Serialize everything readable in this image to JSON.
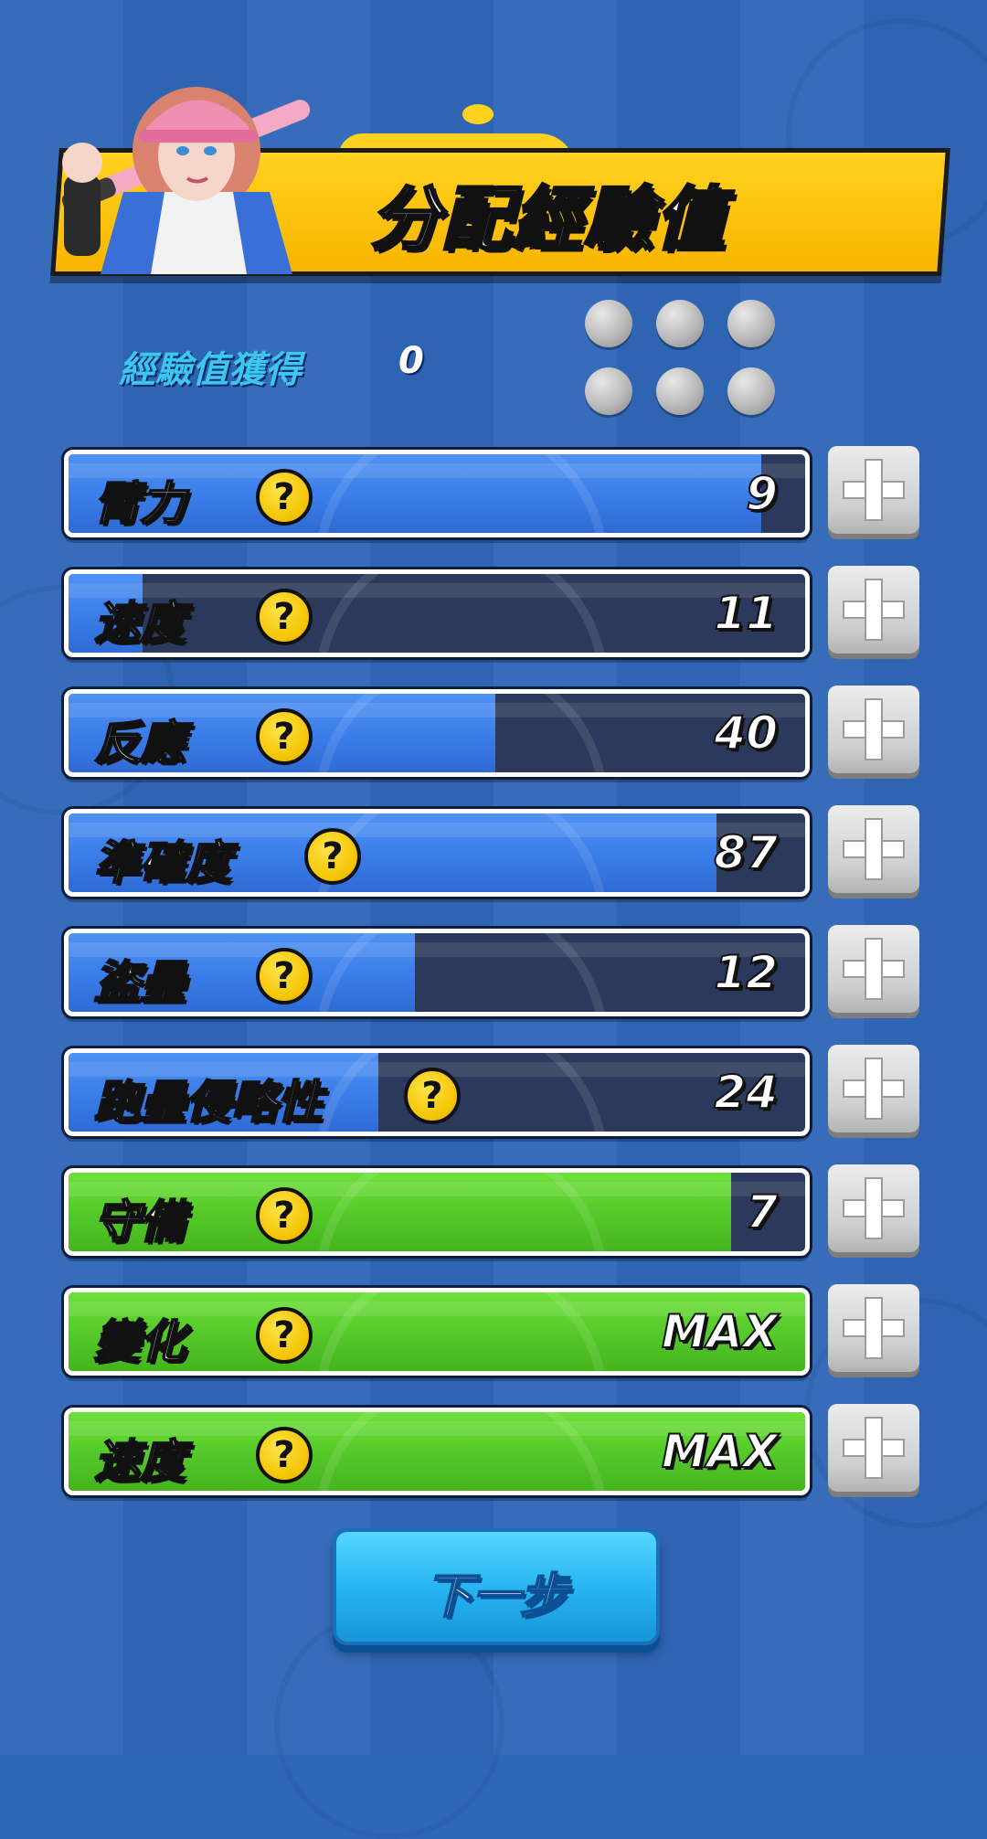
{
  "header": {
    "title": "分配經驗值"
  },
  "exp": {
    "label": "經驗值獲得",
    "value": "0"
  },
  "stats": [
    {
      "name": "臂力",
      "value": "9",
      "fill": 0.94,
      "color": "blue"
    },
    {
      "name": "速度",
      "value": "11",
      "fill": 0.1,
      "color": "blue"
    },
    {
      "name": "反應",
      "value": "40",
      "fill": 0.58,
      "color": "blue"
    },
    {
      "name": "準確度",
      "value": "87",
      "fill": 0.88,
      "color": "blue"
    },
    {
      "name": "盜壘",
      "value": "12",
      "fill": 0.47,
      "color": "blue"
    },
    {
      "name": "跑壘侵略性",
      "value": "24",
      "fill": 0.42,
      "color": "blue"
    },
    {
      "name": "守備",
      "value": "7",
      "fill": 0.9,
      "color": "green"
    },
    {
      "name": "變化",
      "value": "MAX",
      "fill": 1.0,
      "color": "green"
    },
    {
      "name": "速度",
      "value": "MAX",
      "fill": 1.0,
      "color": "green"
    }
  ],
  "help_symbol": "?",
  "next_button": {
    "label": "下一步"
  },
  "colors": {
    "blue_fill": "#3a7de8",
    "green_fill": "#54c828",
    "track": "#2b3a5c",
    "banner": "#ffd21f"
  }
}
